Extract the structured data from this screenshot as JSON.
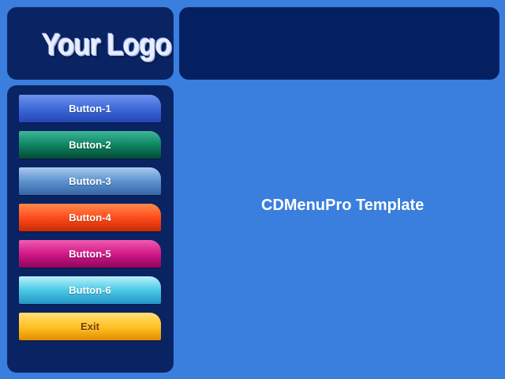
{
  "logo": {
    "text": "Your Logo"
  },
  "menu": {
    "items": [
      {
        "label": "Button-1"
      },
      {
        "label": "Button-2"
      },
      {
        "label": "Button-3"
      },
      {
        "label": "Button-4"
      },
      {
        "label": "Button-5"
      },
      {
        "label": "Button-6"
      },
      {
        "label": "Exit"
      }
    ]
  },
  "content": {
    "title": "CDMenuPro Template"
  },
  "colors": {
    "background": "#3a7fde",
    "panel": "#0a2363",
    "button_1": "#3f69d8",
    "button_2": "#118a67",
    "button_3": "#5d92cf",
    "button_4": "#ff4d1c",
    "button_5": "#d21887",
    "button_6": "#4cc9e6",
    "button_exit": "#ffbf1f"
  }
}
